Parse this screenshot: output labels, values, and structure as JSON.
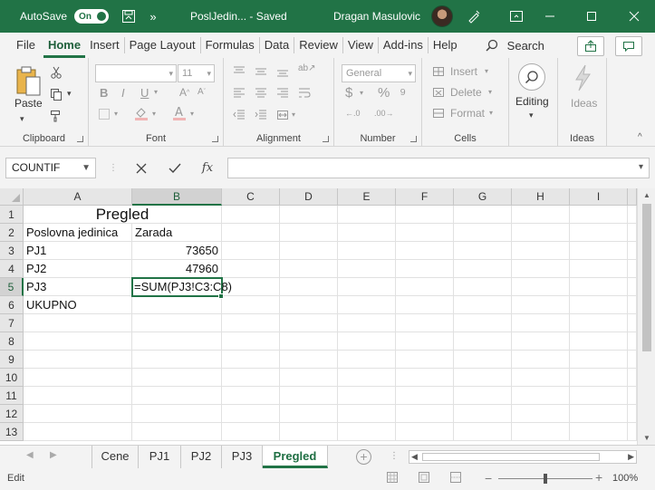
{
  "titlebar": {
    "autosave_label": "AutoSave",
    "autosave_state": "On",
    "doc_title": "PoslJedin...  -  Saved",
    "user_name": "Dragan Masulovic"
  },
  "menu": {
    "items": [
      "File",
      "Home",
      "Insert",
      "Page Layout",
      "Formulas",
      "Data",
      "Review",
      "View",
      "Add-ins",
      "Help"
    ],
    "search_label": "Search"
  },
  "ribbon": {
    "clipboard": {
      "paste_label": "Paste",
      "group_label": "Clipboard"
    },
    "font": {
      "font_name": "",
      "font_size": "11",
      "group_label": "Font"
    },
    "alignment": {
      "group_label": "Alignment"
    },
    "number": {
      "format": "General",
      "group_label": "Number"
    },
    "cells": {
      "insert_label": "Insert",
      "delete_label": "Delete",
      "format_label": "Format",
      "group_label": "Cells"
    },
    "editing": {
      "label": "Editing"
    },
    "ideas": {
      "label": "Ideas",
      "group_label": "Ideas"
    }
  },
  "formula_bar": {
    "name_box": "COUNTIF",
    "formula": ""
  },
  "sheet": {
    "columns": [
      "A",
      "B",
      "C",
      "D",
      "E",
      "F",
      "G",
      "H",
      "I"
    ],
    "rows": [
      "1",
      "2",
      "3",
      "4",
      "5",
      "6",
      "7",
      "8",
      "9",
      "10",
      "11",
      "12",
      "13"
    ],
    "title": "Pregled",
    "header_a": "Poslovna jedinica",
    "header_b": "Zarada",
    "r3_a": "PJ1",
    "r3_b": "73650",
    "r4_a": "PJ2",
    "r4_b": "47960",
    "r5_a": "PJ3",
    "r5_b": "=SUM(PJ3!C3:C8)",
    "r6_a": "UKUPNO"
  },
  "tabs": [
    "Cene",
    "PJ1",
    "PJ2",
    "PJ3",
    "Pregled"
  ],
  "status": {
    "mode": "Edit",
    "zoom": "100%"
  }
}
